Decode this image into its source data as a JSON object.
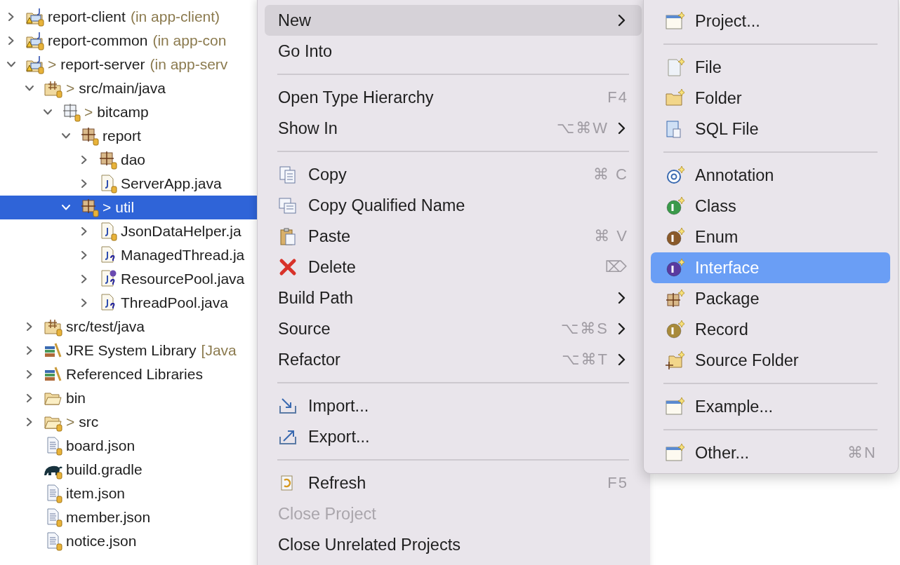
{
  "tree": {
    "items": [
      {
        "label": "report-client",
        "suffix": "(in app-client)",
        "kind": "project",
        "expanded": false,
        "selected": false
      },
      {
        "label": "report-common",
        "suffix": "(in app-con",
        "kind": "project",
        "expanded": false,
        "selected": false
      },
      {
        "label": "report-server",
        "marker": ">",
        "suffix": "(in app-serv",
        "kind": "project",
        "expanded": true,
        "selected": false,
        "children": [
          {
            "label": "src/main/java",
            "marker": ">",
            "kind": "source-folder",
            "expanded": true,
            "selected": false,
            "children": [
              {
                "label": "bitcamp",
                "marker": ">",
                "kind": "package-empty",
                "expanded": true,
                "selected": false,
                "children": [
                  {
                    "label": "report",
                    "kind": "package",
                    "expanded": true,
                    "selected": false,
                    "children": [
                      {
                        "label": "dao",
                        "kind": "package",
                        "expanded": false,
                        "selected": false
                      },
                      {
                        "label": "ServerApp.java",
                        "kind": "java-file",
                        "expanded": false,
                        "selected": false
                      }
                    ]
                  },
                  {
                    "label": "util",
                    "marker": ">",
                    "kind": "package",
                    "expanded": true,
                    "selected": true,
                    "children": [
                      {
                        "label": "JsonDataHelper.ja",
                        "kind": "java-file",
                        "expanded": false,
                        "selected": false
                      },
                      {
                        "label": "ManagedThread.ja",
                        "kind": "java-unknown",
                        "expanded": false,
                        "selected": false
                      },
                      {
                        "label": "ResourcePool.java",
                        "kind": "java-interface",
                        "expanded": false,
                        "selected": false
                      },
                      {
                        "label": "ThreadPool.java",
                        "kind": "java-unknown",
                        "expanded": false,
                        "selected": false
                      }
                    ]
                  }
                ]
              }
            ]
          },
          {
            "label": "src/test/java",
            "kind": "source-folder",
            "expanded": false,
            "selected": false
          },
          {
            "label": "JRE System Library",
            "suffix": "[Java",
            "kind": "library",
            "expanded": false,
            "selected": false
          },
          {
            "label": "Referenced Libraries",
            "kind": "library",
            "expanded": false,
            "selected": false
          },
          {
            "label": "bin",
            "kind": "folder",
            "expanded": false,
            "selected": false
          },
          {
            "label": "src",
            "marker": ">",
            "kind": "folder-tracked",
            "expanded": false,
            "selected": false
          },
          {
            "label": "board.json",
            "kind": "text-file",
            "selected": false
          },
          {
            "label": "build.gradle",
            "kind": "gradle",
            "selected": false
          },
          {
            "label": "item.json",
            "kind": "text-file",
            "selected": false
          },
          {
            "label": "member.json",
            "kind": "text-file",
            "selected": false
          },
          {
            "label": "notice.json",
            "kind": "text-file",
            "selected": false
          }
        ]
      }
    ]
  },
  "context_menu": {
    "items": [
      {
        "kind": "item",
        "label": "New",
        "submenu": true,
        "disabled": false,
        "selected": true
      },
      {
        "kind": "item",
        "label": "Go Into",
        "submenu": false,
        "disabled": false,
        "selected": false
      },
      {
        "kind": "separator"
      },
      {
        "kind": "item",
        "label": "Open Type Hierarchy",
        "shortcut": "F4",
        "submenu": false,
        "disabled": false,
        "selected": false
      },
      {
        "kind": "item",
        "label": "Show In",
        "shortcut": "⌥⌘W",
        "submenu": true,
        "disabled": false,
        "selected": false
      },
      {
        "kind": "separator"
      },
      {
        "kind": "item",
        "label": "Copy",
        "shortcut": "⌘ C",
        "submenu": false,
        "disabled": false,
        "selected": false
      },
      {
        "kind": "item",
        "label": "Copy Qualified Name",
        "submenu": false,
        "disabled": false,
        "selected": false
      },
      {
        "kind": "item",
        "label": "Paste",
        "shortcut": "⌘ V",
        "submenu": false,
        "disabled": false,
        "selected": false
      },
      {
        "kind": "item",
        "label": "Delete",
        "shortcut": "⌦",
        "submenu": false,
        "disabled": false,
        "selected": false
      },
      {
        "kind": "item",
        "label": "Build Path",
        "submenu": true,
        "disabled": false,
        "selected": false
      },
      {
        "kind": "item",
        "label": "Source",
        "shortcut": "⌥⌘S",
        "submenu": true,
        "disabled": false,
        "selected": false
      },
      {
        "kind": "item",
        "label": "Refactor",
        "shortcut": "⌥⌘T",
        "submenu": true,
        "disabled": false,
        "selected": false
      },
      {
        "kind": "separator"
      },
      {
        "kind": "item",
        "label": "Import...",
        "submenu": false,
        "disabled": false,
        "selected": false
      },
      {
        "kind": "item",
        "label": "Export...",
        "submenu": false,
        "disabled": false,
        "selected": false
      },
      {
        "kind": "separator"
      },
      {
        "kind": "item",
        "label": "Refresh",
        "shortcut": "F5",
        "submenu": false,
        "disabled": false,
        "selected": false
      },
      {
        "kind": "item",
        "label": "Close Project",
        "submenu": false,
        "disabled": true,
        "selected": false
      },
      {
        "kind": "item",
        "label": "Close Unrelated Projects",
        "submenu": false,
        "disabled": false,
        "selected": false
      }
    ]
  },
  "submenu": {
    "items": [
      {
        "kind": "item",
        "label": "Project...",
        "selected": false
      },
      {
        "kind": "separator"
      },
      {
        "kind": "item",
        "label": "File",
        "selected": false
      },
      {
        "kind": "item",
        "label": "Folder",
        "selected": false
      },
      {
        "kind": "item",
        "label": "SQL File",
        "selected": false
      },
      {
        "kind": "separator"
      },
      {
        "kind": "item",
        "label": "Annotation",
        "selected": false
      },
      {
        "kind": "item",
        "label": "Class",
        "selected": false
      },
      {
        "kind": "item",
        "label": "Enum",
        "selected": false
      },
      {
        "kind": "item",
        "label": "Interface",
        "selected": true
      },
      {
        "kind": "item",
        "label": "Package",
        "selected": false
      },
      {
        "kind": "item",
        "label": "Record",
        "selected": false
      },
      {
        "kind": "item",
        "label": "Source Folder",
        "selected": false
      },
      {
        "kind": "separator"
      },
      {
        "kind": "item",
        "label": "Example...",
        "selected": false
      },
      {
        "kind": "separator"
      },
      {
        "kind": "item",
        "label": "Other...",
        "shortcut": "⌘N",
        "selected": false
      }
    ]
  }
}
